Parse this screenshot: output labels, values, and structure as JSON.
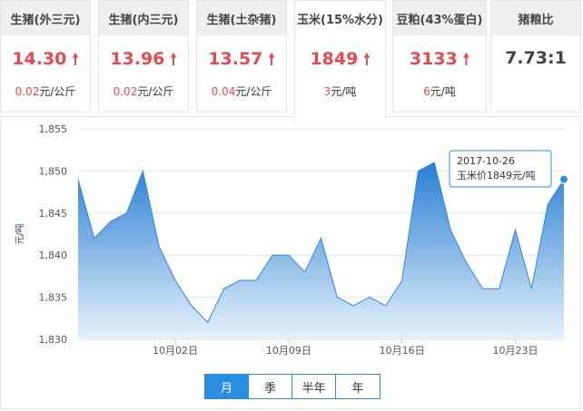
{
  "cards": [
    {
      "title": "生猪(外三元)",
      "price": "14.30",
      "change": "0.02",
      "unit": "元/公斤"
    },
    {
      "title": "生猪(内三元)",
      "price": "13.96",
      "change": "0.02",
      "unit": "元/公斤"
    },
    {
      "title": "生猪(土杂猪)",
      "price": "13.57",
      "change": "0.04",
      "unit": "元/公斤"
    },
    {
      "title": "玉米(15%水分)",
      "price": "1849",
      "change": "3",
      "unit": "元/吨"
    },
    {
      "title": "豆粕(43%蛋白)",
      "price": "3133",
      "change": "6",
      "unit": "元/吨"
    }
  ],
  "ratio_card": {
    "title": "猪粮比",
    "value": "7.73:1"
  },
  "up_arrow": "🠕",
  "periods": [
    "月",
    "季",
    "半年",
    "年"
  ],
  "active_period": "月",
  "colors": {
    "accent": "#2a8ee0",
    "up": "#e8494d"
  },
  "chart_data": {
    "type": "area",
    "ylabel": "元/吨",
    "ylim": [
      1830,
      1855
    ],
    "yticks": [
      "1,855",
      "1,850",
      "1,845",
      "1,840",
      "1,835",
      "1,830"
    ],
    "xticks": [
      "10月02日",
      "10月09日",
      "10月16日",
      "10月23日"
    ],
    "x": [
      "09-27",
      "09-28",
      "09-29",
      "09-30",
      "10-01",
      "10-02",
      "10-03",
      "10-04",
      "10-05",
      "10-06",
      "10-07",
      "10-08",
      "10-09",
      "10-10",
      "10-11",
      "10-12",
      "10-13",
      "10-14",
      "10-15",
      "10-16",
      "10-17",
      "10-18",
      "10-19",
      "10-20",
      "10-21",
      "10-22",
      "10-23",
      "10-24",
      "10-25",
      "10-26"
    ],
    "values": [
      1849,
      1842,
      1844,
      1845,
      1850,
      1841,
      1837,
      1834,
      1832,
      1836,
      1837,
      1837,
      1840,
      1840,
      1838,
      1842,
      1835,
      1834,
      1835,
      1834,
      1837,
      1850,
      1851,
      1843,
      1839,
      1836,
      1836,
      1843,
      1836,
      1846,
      1849
    ],
    "tooltip": {
      "date": "2017-10-26",
      "text": "玉米价1849元/吨"
    }
  }
}
